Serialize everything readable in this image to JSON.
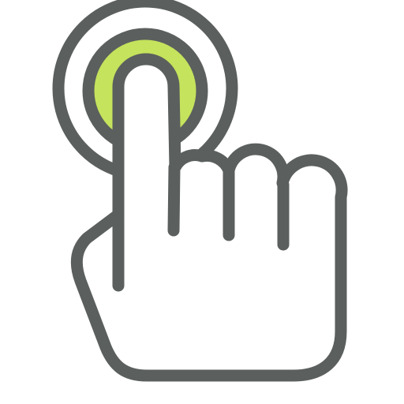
{
  "icon": {
    "name": "tap-gesture-icon",
    "colors": {
      "outline": "#5B5F5E",
      "accent": "#C5E35C",
      "fill": "#FFFFFF"
    }
  }
}
